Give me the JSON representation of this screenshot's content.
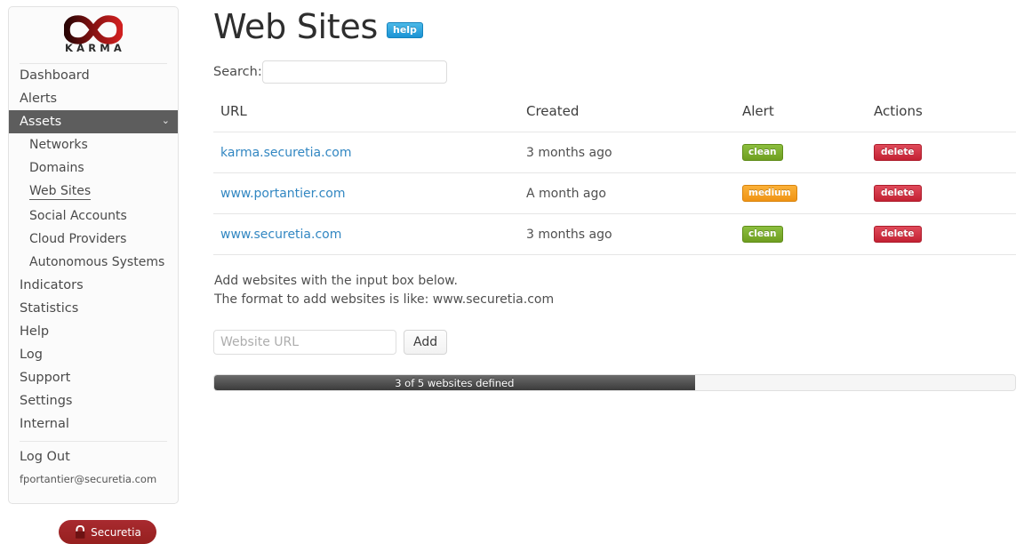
{
  "sidebar": {
    "logo": {
      "wordmark": "KARMA",
      "icon": "infinity-icon"
    },
    "nav": [
      {
        "label": "Dashboard",
        "type": "top",
        "state": "normal"
      },
      {
        "label": "Alerts",
        "type": "top",
        "state": "normal"
      },
      {
        "label": "Assets",
        "type": "top",
        "state": "active",
        "chevron": "chevron-down-icon"
      },
      {
        "label": "Networks",
        "type": "sub",
        "state": "normal"
      },
      {
        "label": "Domains",
        "type": "sub",
        "state": "normal"
      },
      {
        "label": "Web Sites",
        "type": "sub",
        "state": "current"
      },
      {
        "label": "Social Accounts",
        "type": "sub",
        "state": "normal"
      },
      {
        "label": "Cloud Providers",
        "type": "sub",
        "state": "normal"
      },
      {
        "label": "Autonomous Systems",
        "type": "sub",
        "state": "normal"
      },
      {
        "label": "Indicators",
        "type": "top",
        "state": "normal"
      },
      {
        "label": "Statistics",
        "type": "top",
        "state": "normal"
      },
      {
        "label": "Help",
        "type": "top",
        "state": "normal"
      },
      {
        "label": "Log",
        "type": "top",
        "state": "normal"
      },
      {
        "label": "Support",
        "type": "top",
        "state": "normal"
      },
      {
        "label": "Settings",
        "type": "top",
        "state": "normal"
      },
      {
        "label": "Internal",
        "type": "top",
        "state": "normal"
      }
    ],
    "logout_label": "Log Out",
    "user_email": "fportantier@securetia.com",
    "brand_badge": {
      "label": "Securetia",
      "icon": "lock-icon",
      "color": "#9e2228"
    }
  },
  "header": {
    "title": "Web Sites",
    "help_badge": "help",
    "help_badge_color": "#1a93d4"
  },
  "search": {
    "label": "Search:",
    "value": "",
    "placeholder": ""
  },
  "table": {
    "columns": [
      "URL",
      "Created",
      "Alert",
      "Actions"
    ],
    "rows": [
      {
        "url": "karma.securetia.com",
        "created": "3 months ago",
        "alert": "clean",
        "alert_color": "#6f9e20",
        "action": "delete"
      },
      {
        "url": "www.portantier.com",
        "created": "A month ago",
        "alert": "medium",
        "alert_color": "#f09415",
        "action": "delete"
      },
      {
        "url": "www.securetia.com",
        "created": "3 months ago",
        "alert": "clean",
        "alert_color": "#6f9e20",
        "action": "delete"
      }
    ]
  },
  "add_form": {
    "help_line_1": "Add websites with the input box below.",
    "help_line_2": "The format to add websites is like: www.securetia.com",
    "input_value": "",
    "input_placeholder": "Website URL",
    "button_label": "Add"
  },
  "progress": {
    "label": "3 of 5 websites defined",
    "current": 3,
    "total": 5,
    "percent": 60
  }
}
